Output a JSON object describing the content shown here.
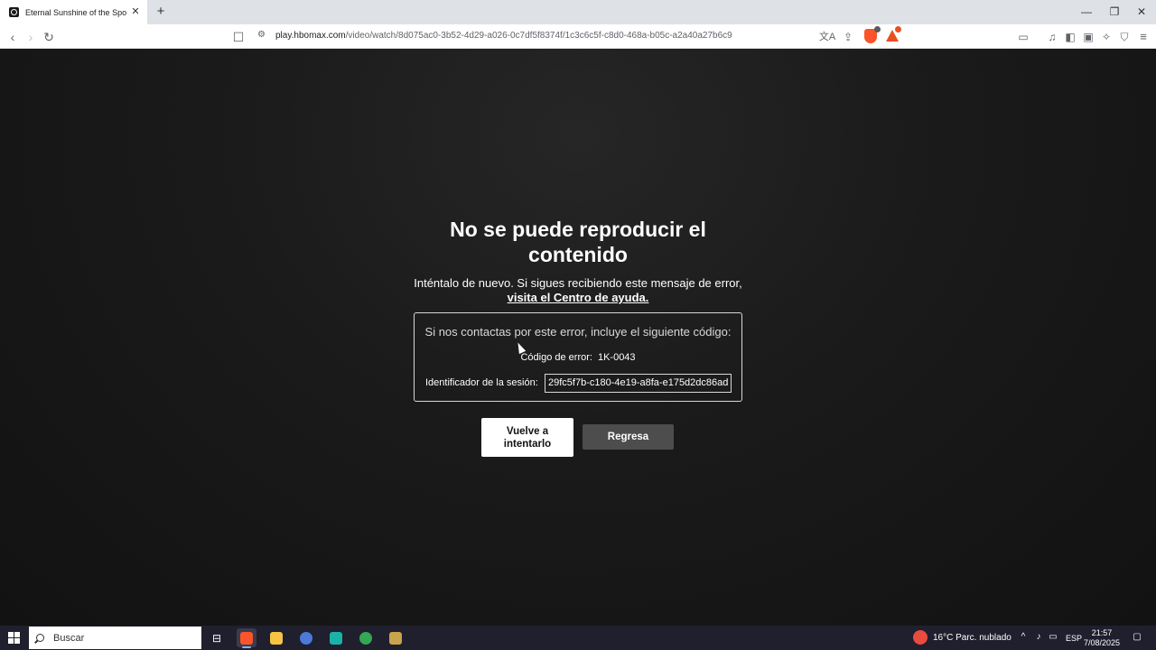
{
  "browser": {
    "tab": {
      "title": "Eternal Sunshine of the Spotless Mind"
    },
    "url": {
      "host": "play.hbomax.com",
      "path": "/video/watch/8d075ac0-3b52-4d29-a026-0c7df5f8374f/1c3c6c5f-c8d0-468a-b05c-a2a40a27b6c9"
    }
  },
  "error": {
    "title": "No se puede reproducir el contenido",
    "description": "Inténtalo de nuevo. Si sigues recibiendo este mensaje de error,",
    "help_link": "visita el Centro de ayuda.",
    "contact_text": "Si nos contactas por este error, incluye el siguiente código:",
    "code_label": "Código de error:",
    "code_value": "1K-0043",
    "session_label": "Identificador de la sesión:",
    "session_value": "29fc5f7b-c180-4e19-a8fa-e175d2dc86ad"
  },
  "buttons": {
    "retry": "Vuelve a intentarlo",
    "back": "Regresa"
  },
  "taskbar": {
    "search_placeholder": "Buscar",
    "weather": "16°C  Parc. nublado",
    "language": "ESP",
    "time": "21:57",
    "date": "7/08/2025"
  },
  "icons": {
    "back": "arrow-left-icon",
    "forward": "arrow-right-icon",
    "reload": "reload-icon",
    "bookmark": "bookmark-icon",
    "translate": "translate-icon",
    "share": "share-icon",
    "brave_shields": "brave-shield-icon",
    "brave_rewards": "brave-rewards-icon",
    "menu": "hamburger-menu-icon"
  },
  "colors": {
    "background": "#151515",
    "primary_button": "#ffffff",
    "secondary_button": "#4d4d4d",
    "text": "#ffffff"
  }
}
